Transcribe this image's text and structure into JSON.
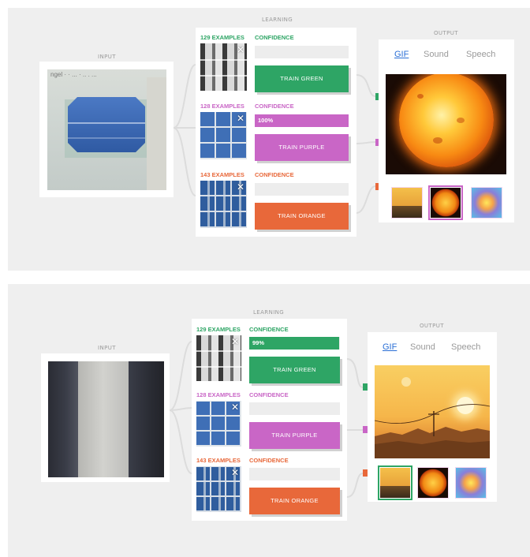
{
  "panels": [
    {
      "labels": {
        "input": "INPUT",
        "learning": "LEARNING",
        "output": "OUTPUT"
      },
      "input_text": "ngel · · ... · .. . ...",
      "classes": [
        {
          "examples": "129 EXAMPLES",
          "confidence_label": "CONFIDENCE",
          "confidence_value": "",
          "confidence_fill": 0,
          "train_label": "TRAIN GREEN",
          "color": "#2ea565"
        },
        {
          "examples": "128 EXAMPLES",
          "confidence_label": "CONFIDENCE",
          "confidence_value": "100%",
          "confidence_fill": 1.0,
          "train_label": "TRAIN PURPLE",
          "color": "#c966c6"
        },
        {
          "examples": "143 EXAMPLES",
          "confidence_label": "CONFIDENCE",
          "confidence_value": "",
          "confidence_fill": 0,
          "train_label": "TRAIN ORANGE",
          "color": "#e8683a"
        }
      ],
      "tabs": [
        "GIF",
        "Sound",
        "Speech"
      ],
      "active_tab": "GIF",
      "output_selected": "sun"
    },
    {
      "labels": {
        "input": "INPUT",
        "learning": "LEARNING",
        "output": "OUTPUT"
      },
      "classes": [
        {
          "examples": "129 EXAMPLES",
          "confidence_label": "CONFIDENCE",
          "confidence_value": "99%",
          "confidence_fill": 0.99,
          "train_label": "TRAIN GREEN",
          "color": "#2ea565"
        },
        {
          "examples": "128 EXAMPLES",
          "confidence_label": "CONFIDENCE",
          "confidence_value": "",
          "confidence_fill": 0,
          "train_label": "TRAIN PURPLE",
          "color": "#c966c6"
        },
        {
          "examples": "143 EXAMPLES",
          "confidence_label": "CONFIDENCE",
          "confidence_value": "",
          "confidence_fill": 0,
          "train_label": "TRAIN ORANGE",
          "color": "#e8683a"
        }
      ],
      "tabs": [
        "GIF",
        "Sound",
        "Speech"
      ],
      "active_tab": "GIF",
      "output_selected": "sunset"
    }
  ],
  "icons": {
    "remove": "close-icon"
  }
}
